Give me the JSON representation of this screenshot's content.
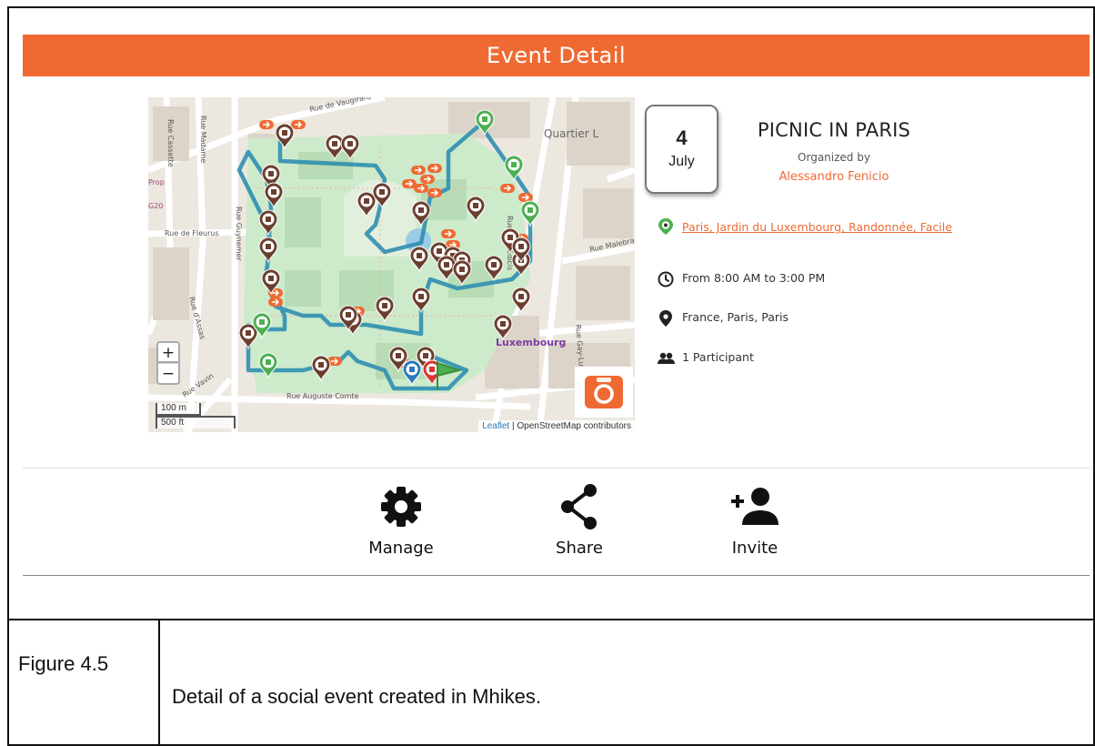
{
  "header": {
    "title": "Event Detail"
  },
  "map": {
    "zoom_in_label": "+",
    "zoom_out_label": "−",
    "scale_metric": "100 m",
    "scale_imperial": "500 ft",
    "attribution_leaflet": "Leaflet",
    "attribution_rest": " | OpenStreetMap contributors",
    "street_labels": [
      "Rue de Vaugirard",
      "Rue de Fleurus",
      "Rue Auguste Comte",
      "Rue Vavin",
      "Rue Guynemer",
      "Rue Madame",
      "Rue Cassette",
      "Rue d'Assas",
      "Quartier L",
      "Luxembourg",
      "Rue de Médicis",
      "Rue Gay-Lussac",
      "Rue Malebranche",
      "G20"
    ],
    "camera_icon": "camera-icon",
    "colors": {
      "route": "#2f8fb0",
      "park": "#cdeacb",
      "poi_brown": "#6b3f2f",
      "poi_orange": "#ef6a33",
      "poi_green": "#4caf50"
    }
  },
  "event": {
    "day": "4",
    "month": "July",
    "title": "PICNIC IN PARIS",
    "organized_by_label": "Organized by",
    "organizer": "Alessandro Fenicio",
    "tags": "Paris, Jardin du Luxembourg, Randonnée, Facile",
    "time": "From 8:00 AM to 3:00 PM",
    "location": "France, Paris, Paris",
    "participants": "1 Participant"
  },
  "actions": [
    {
      "label": "Manage",
      "icon": "gear-icon"
    },
    {
      "label": "Share",
      "icon": "share-icon"
    },
    {
      "label": "Invite",
      "icon": "add-user-icon"
    }
  ],
  "caption": {
    "label": "Figure 4.5",
    "text": "Detail of a social event created in Mhikes."
  },
  "colors": {
    "accent": "#ef6a33",
    "text": "#222222"
  }
}
